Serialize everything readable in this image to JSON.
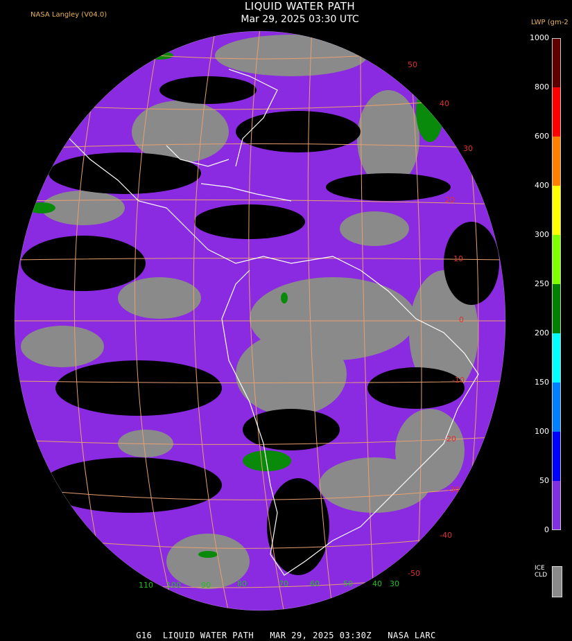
{
  "header": {
    "title": "LIQUID WATER PATH",
    "subtitle": "Mar 29, 2025 03:30 UTC",
    "org_label": "NASA Langley (V04.0)"
  },
  "legend": {
    "unit_label": "LWP (gm-2",
    "ticks": [
      "1000",
      "800",
      "600",
      "400",
      "300",
      "250",
      "200",
      "150",
      "100",
      "50",
      "0"
    ],
    "colors": [
      "#5c0000",
      "#ff0000",
      "#ff8000",
      "#ffff00",
      "#80ff00",
      "#008000",
      "#00ffff",
      "#0080ff",
      "#0000ff",
      "#8030e0"
    ],
    "ice_label_line1": "ICE",
    "ice_label_line2": "CLD",
    "ice_color": "#8a8a8a"
  },
  "map": {
    "lat_labels": [
      "50",
      "40",
      "30",
      "20",
      "10",
      "0",
      "-10",
      "-20",
      "-30",
      "-40",
      "-50"
    ],
    "lon_labels": [
      "110",
      "100",
      "90",
      "80",
      "70",
      "60",
      "50",
      "40",
      "30"
    ],
    "grid_color": "#e8a070",
    "lat_label_color": "#e03030",
    "lon_label_color": "#20c020",
    "cloud_colors": {
      "water": "#8a2be2",
      "ice": "#8a8a8a",
      "heavy": "#0a8a0a",
      "clear": "#000000"
    }
  },
  "footer": {
    "text": "G16  LIQUID WATER PATH   MAR 29, 2025 03:30Z   NASA LARC"
  }
}
